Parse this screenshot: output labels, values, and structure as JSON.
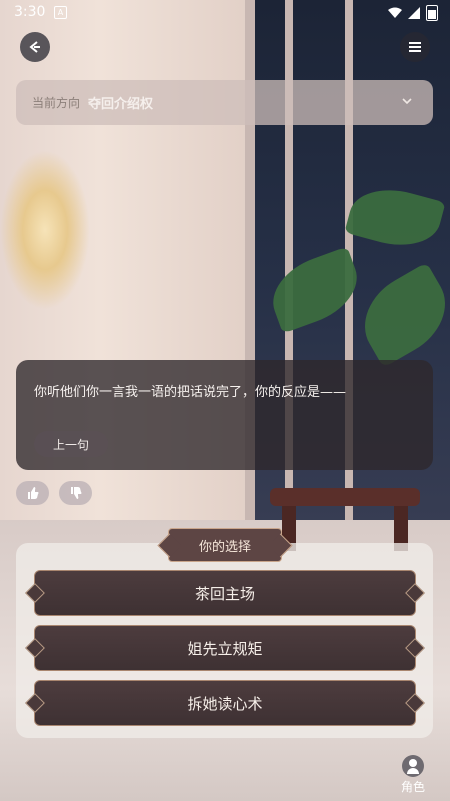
{
  "status_bar": {
    "time": "3:30",
    "notification_glyph": "A"
  },
  "direction": {
    "label": "当前方向",
    "value": "夺回介绍权"
  },
  "dialog": {
    "text": "你听他们你一言我一语的把话说完了，你的反应是——",
    "prev_button": "上一句"
  },
  "choice_panel": {
    "title": "你的选择",
    "options": [
      "茶回主场",
      "姐先立规矩",
      "拆她读心术"
    ]
  },
  "role_button": {
    "label": "角色"
  },
  "icons": {
    "back": "back-arrow-icon",
    "menu": "menu-icon",
    "chevron": "chevron-down-icon",
    "like": "thumb-up-icon",
    "dislike": "thumb-down-icon",
    "role": "user-icon"
  },
  "colors": {
    "dialog_bg": "#2e282c",
    "choice_bg": "#4d3c3e",
    "choice_border": "#a9866f"
  }
}
